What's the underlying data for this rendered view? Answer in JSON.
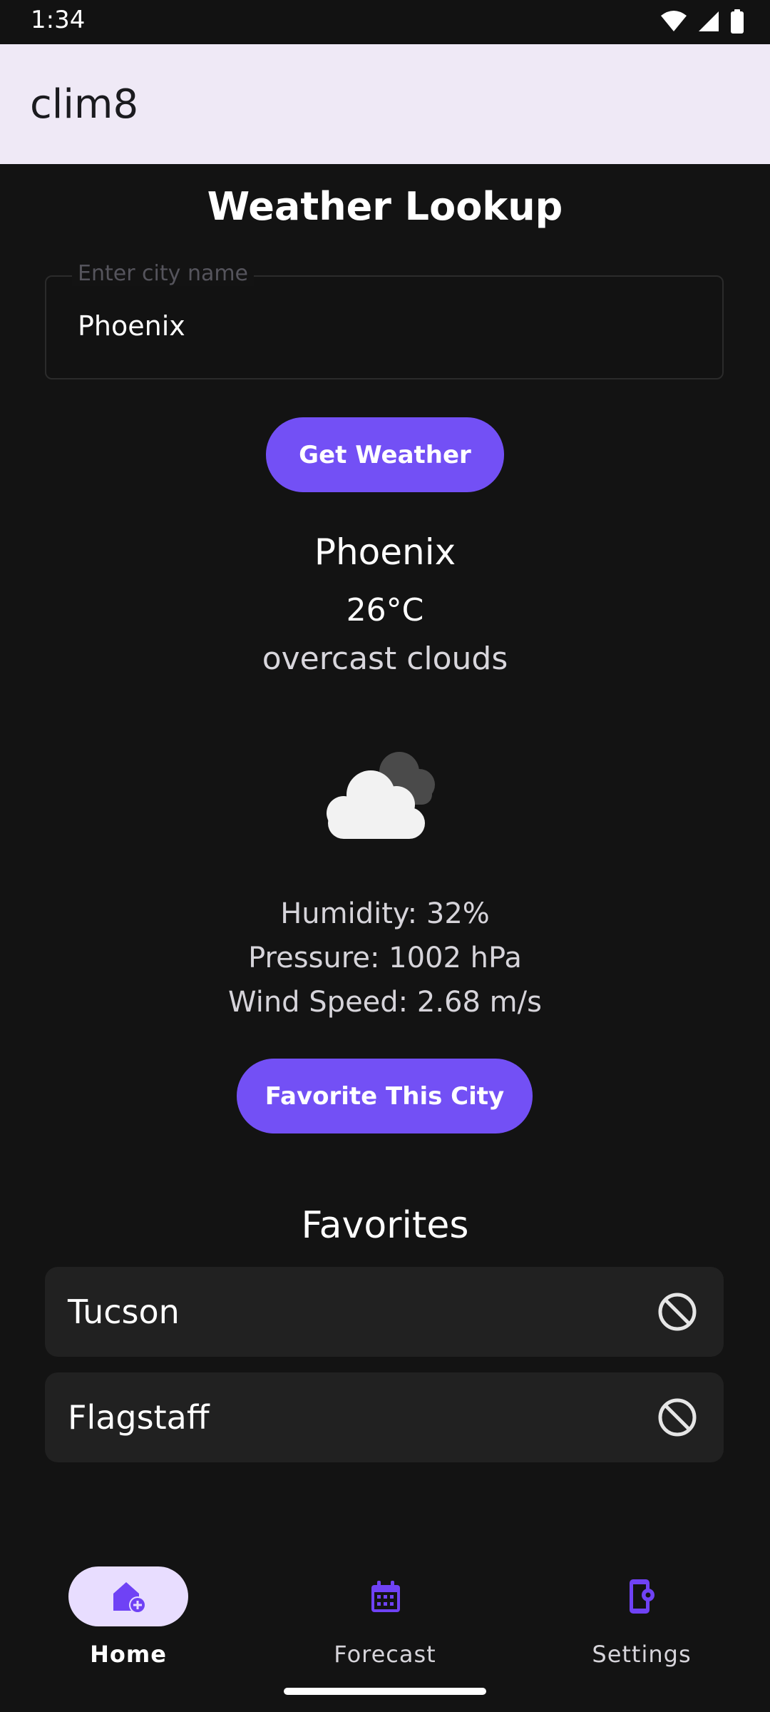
{
  "status": {
    "time": "1:34",
    "icons": [
      "wifi-icon",
      "signal-icon",
      "battery-icon"
    ]
  },
  "app": {
    "title": "clim8"
  },
  "page": {
    "heading": "Weather Lookup"
  },
  "search": {
    "label": "Enter city name",
    "value": "Phoenix"
  },
  "buttons": {
    "get_weather": "Get Weather",
    "favorite": "Favorite This City"
  },
  "weather": {
    "city": "Phoenix",
    "temperature": "26°C",
    "description": "overcast clouds",
    "icon": "overcast-clouds-icon",
    "humidity": "Humidity: 32%",
    "pressure": "Pressure: 1002 hPa",
    "wind": "Wind Speed: 2.68 m/s"
  },
  "favorites": {
    "title": "Favorites",
    "items": [
      {
        "label": "Tucson",
        "icon": "remove-icon"
      },
      {
        "label": "Flagstaff",
        "icon": "remove-icon"
      }
    ]
  },
  "nav": {
    "items": [
      {
        "label": "Home",
        "icon": "home-icon",
        "active": true
      },
      {
        "label": "Forecast",
        "icon": "calendar-icon",
        "active": false
      },
      {
        "label": "Settings",
        "icon": "settings-phone-icon",
        "active": false
      }
    ]
  },
  "colors": {
    "accent": "#7350F5",
    "background": "#131313",
    "app_bar": "#EFE9F6",
    "card": "#212121",
    "nav_pill": "#E8DDFF",
    "nav_icon": "#6F42F5"
  }
}
